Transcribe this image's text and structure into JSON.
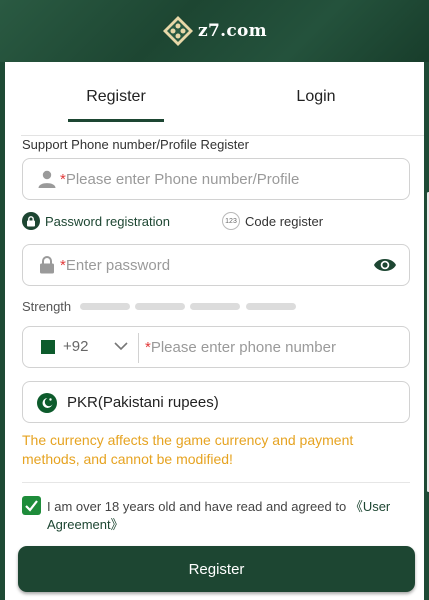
{
  "header": {
    "site_name": "z7.com"
  },
  "tabs": {
    "register": "Register",
    "login": "Login"
  },
  "form": {
    "account_label": "Support Phone number/Profile Register",
    "account_placeholder": "Please enter Phone number/Profile",
    "required_mark": "*",
    "mode_password": "Password registration",
    "mode_code": "Code register",
    "code_icon_text": "123",
    "password_placeholder": "Enter password",
    "strength_label": "Strength",
    "strength_level": 0,
    "country_code": "+92",
    "phone_placeholder": "Please enter phone number",
    "currency": "PKR(Pakistani rupees)",
    "currency_note": "The currency affects the game currency and payment methods, and cannot be modified!",
    "agree_text": "I am over 18 years old and have read and agreed to ",
    "agree_link": "《User Agreement》",
    "agree_checked": true,
    "submit": "Register"
  },
  "colors": {
    "brand": "#1d4632",
    "warning": "#e6a321",
    "required": "#e23a3a",
    "checkbox": "#1e8c3a"
  },
  "icons": [
    "user-icon",
    "lock-icon",
    "eye-icon",
    "chevron-down-icon",
    "pakistan-flag-icon",
    "checkmark-icon"
  ]
}
